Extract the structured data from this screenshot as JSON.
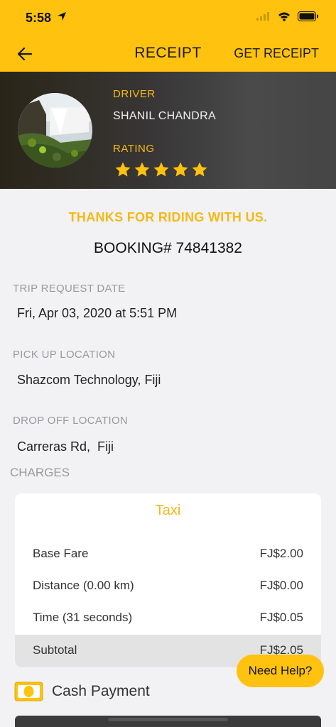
{
  "status_bar": {
    "time": "5:58"
  },
  "nav": {
    "title": "RECEIPT",
    "get_receipt": "GET RECEIPT"
  },
  "driver": {
    "label": "DRIVER",
    "name": "SHANIL CHANDRA",
    "rating_label": "RATING",
    "rating": 5,
    "rating_max": 5
  },
  "summary": {
    "thanks": "THANKS FOR RIDING WITH US.",
    "booking": "BOOKING# 74841382"
  },
  "trip": {
    "request_date_label": "TRIP REQUEST DATE",
    "request_date": "Fri, Apr 03, 2020 at 5:51 PM",
    "pickup_label": "PICK UP LOCATION",
    "pickup": "Shazcom Technology, Fiji",
    "dropoff_label": "DROP OFF LOCATION",
    "dropoff": "Carreras Rd,  Fiji"
  },
  "charges": {
    "label": "CHARGES",
    "vehicle_type": "Taxi",
    "rows": [
      {
        "name": "Base Fare",
        "amount": "FJ$2.00"
      },
      {
        "name": "Distance (0.00 km)",
        "amount": "FJ$0.00"
      },
      {
        "name": "Time (31 seconds)",
        "amount": "FJ$0.05"
      }
    ],
    "subtotal": {
      "name": "Subtotal",
      "amount": "FJ$2.05"
    }
  },
  "payment": {
    "method": "Cash Payment",
    "icon": "cash-icon"
  },
  "help_button": "Need Help?",
  "colors": {
    "accent": "#ffc20e",
    "accent_text": "#f5b915",
    "background": "#f2f2f4"
  }
}
